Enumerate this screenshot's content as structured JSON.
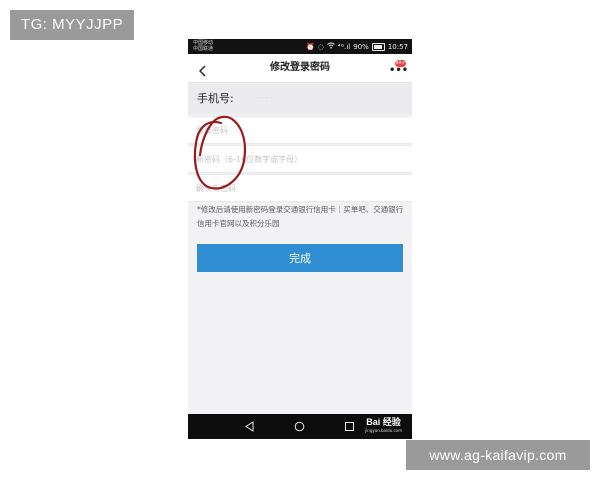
{
  "watermark_top": "TG: MYYJJPP",
  "watermark_bottom": "www.ag-kaifavip.com",
  "status_bar": {
    "carrier_line_1": "中国移动",
    "carrier_line_2": "中国联通",
    "signal_text": "⁴ᴳ.ıl",
    "battery_pct": "90%",
    "time": "10:57"
  },
  "title_bar": {
    "title": "修改登录密码",
    "more_icon": "more-dots-icon",
    "badge": "99+"
  },
  "phone_row": {
    "label": "手机号:",
    "value": "· · · · ·"
  },
  "fields": {
    "login_password_placeholder": "登录密码",
    "new_password_placeholder": "新密码（6-16位数字或字母）",
    "confirm_password_placeholder": "确认新密码"
  },
  "notice": "*修改后请使用新密码登录交通银行信用卡｜买单吧、交通银行信用卡官网以及积分乐园",
  "submit_label": "完成",
  "nav": {
    "logo_text": "Bai 经验",
    "logo_sub": "jingyan.baidu.com"
  },
  "colors": {
    "accent": "#2f8ed1",
    "annotation": "#9b1c1c",
    "watermark_bg": "#9a9a9a"
  }
}
